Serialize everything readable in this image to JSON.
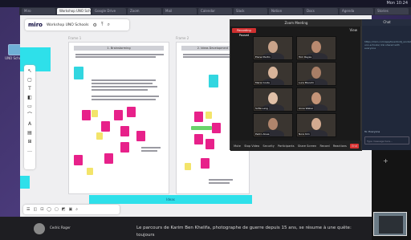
{
  "menubar": {
    "right_text": "Mon 10:24"
  },
  "browser_tabs": [
    "Miro",
    "Workshop UNO Schools",
    "Google Drive",
    "Zoom",
    "Mail",
    "Calendar",
    "Slack",
    "Notion",
    "Docs",
    "Agenda",
    "Stories"
  ],
  "desktop": {
    "icon_label": "UNO Schools"
  },
  "miro": {
    "logo": "miro",
    "board_name": "Workshop UNO Schools",
    "frame1_label": "Frame 1",
    "frame2_label": "Frame 2",
    "frame1_title": "1. Brainstorming",
    "frame2_title": "2. Ideas Development",
    "bottom_bar_label": "Ideas",
    "tools": [
      "↖",
      "▢",
      "T",
      "◧",
      "▭",
      "⌒",
      "A",
      "▤",
      "⊞",
      "…"
    ],
    "bottom_tools": [
      "☰",
      "◫",
      "⊡",
      "◯",
      "▢",
      "◩",
      "▣",
      "⌕"
    ]
  },
  "zoom": {
    "title": "Zoom Meeting",
    "recording": "Recording Paused",
    "view": "View",
    "participants": [
      "Elena Martin",
      "Tom Reyes",
      "Maria Costa",
      "Luca Bianchi",
      "Sofia Lang",
      "Anna Weber",
      "Pedro Alves",
      "Nora Kim"
    ],
    "controls": [
      "Mute",
      "Stop Video",
      "Security",
      "Participants",
      "Share Screen",
      "Record",
      "Reactions",
      "End"
    ]
  },
  "chat": {
    "title": "Chat",
    "message": "https://miro.com/app/board/o9J_workshop-uno-schools/ link shared with everyone",
    "to_label": "To: Everyone",
    "input_placeholder": "Type message here..."
  },
  "article": {
    "user_name": "Cedric Roger",
    "text": "Le parcours de Karim Ben Khelifa, photographe de guerre depuis 15 ans, se résume à une quête: toujours"
  }
}
